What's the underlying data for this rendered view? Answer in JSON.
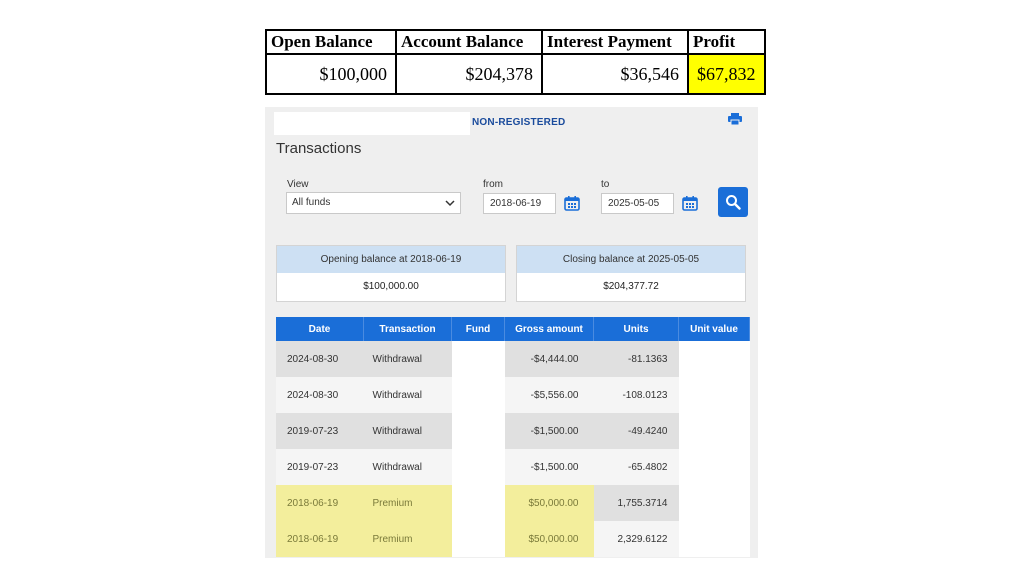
{
  "summary": {
    "headers": [
      "Open Balance",
      "Account Balance",
      "Interest Payment",
      "Profit"
    ],
    "values": [
      "$100,000",
      "$204,378",
      "$36,546",
      "$67,832"
    ],
    "profit_highlight": "#ffff00"
  },
  "panel": {
    "registration": "NON-REGISTERED",
    "title": "Transactions",
    "view_label": "View",
    "view_value": "All funds",
    "from_label": "from",
    "from_value": "2018-06-19",
    "to_label": "to",
    "to_value": "2025-05-05",
    "opening_label": "Opening balance at 2018-06-19",
    "opening_value": "$100,000.00",
    "closing_label": "Closing balance at 2025-05-05",
    "closing_value": "$204,377.72",
    "accent": "#1a6ed8"
  },
  "table": {
    "headers": [
      "Date",
      "Transaction",
      "Fund",
      "Gross amount",
      "Units",
      "Unit value"
    ],
    "rows": [
      {
        "date": "2024-08-30",
        "transaction": "Withdrawal",
        "gross": "-$4,444.00",
        "units": "-81.1363"
      },
      {
        "date": "2024-08-30",
        "transaction": "Withdrawal",
        "gross": "-$5,556.00",
        "units": "-108.0123"
      },
      {
        "date": "2019-07-23",
        "transaction": "Withdrawal",
        "gross": "-$1,500.00",
        "units": "-49.4240"
      },
      {
        "date": "2019-07-23",
        "transaction": "Withdrawal",
        "gross": "-$1,500.00",
        "units": "-65.4802"
      },
      {
        "date": "2018-06-19",
        "transaction": "Premium",
        "gross": "$50,000.00",
        "units": "1,755.3714"
      },
      {
        "date": "2018-06-19",
        "transaction": "Premium",
        "gross": "$50,000.00",
        "units": "2,329.6122"
      }
    ]
  }
}
